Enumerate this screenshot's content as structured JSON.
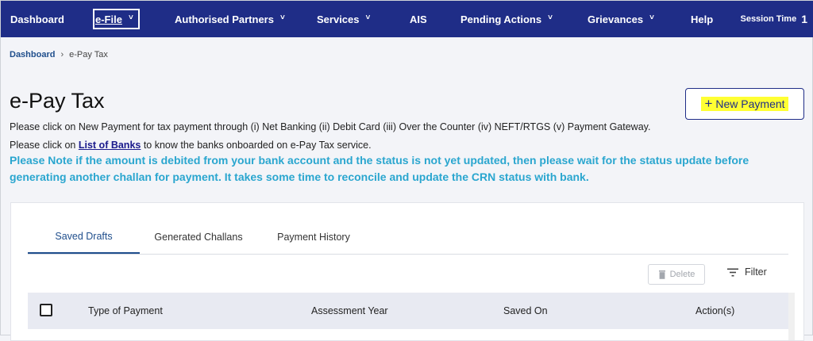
{
  "nav": {
    "items": [
      {
        "label": "Dashboard",
        "chevron": false
      },
      {
        "label": "e-File",
        "chevron": true
      },
      {
        "label": "Authorised Partners",
        "chevron": true
      },
      {
        "label": "Services",
        "chevron": true
      },
      {
        "label": "AIS",
        "chevron": false
      },
      {
        "label": "Pending Actions",
        "chevron": true
      },
      {
        "label": "Grievances",
        "chevron": true
      },
      {
        "label": "Help",
        "chevron": false
      }
    ],
    "session_label": "Session Time",
    "session_value": "1"
  },
  "breadcrumb": {
    "home": "Dashboard",
    "separator": "›",
    "current": "e-Pay Tax"
  },
  "page": {
    "title": "e-Pay Tax",
    "info1": "Please click on New Payment for tax payment through (i) Net Banking (ii) Debit Card (iii) Over the Counter (iv) NEFT/RTGS (v) Payment Gateway.",
    "info2_prefix": "Please click on ",
    "info2_link": "List of Banks",
    "info2_suffix": " to know the banks onboarded on e-Pay Tax service.",
    "notice": "Please Note if the amount is debited from your bank account and the status is not yet updated, then please wait for the status update before generating another challan for payment. It takes some time to reconcile and update the CRN status with bank."
  },
  "new_payment": {
    "icon": "plus-icon",
    "label": "New Payment"
  },
  "tabs": [
    {
      "label": "Saved Drafts",
      "active": true
    },
    {
      "label": "Generated Challans",
      "active": false
    },
    {
      "label": "Payment History",
      "active": false
    }
  ],
  "toolbar": {
    "delete_label": "Delete",
    "delete_icon": "trash-icon",
    "filter_label": "Filter",
    "filter_icon": "filter-icon"
  },
  "table": {
    "columns": [
      "Type of Payment",
      "Assessment Year",
      "Saved On",
      "Action(s)"
    ]
  },
  "colors": {
    "nav_bg": "#1f2d87",
    "notice": "#2aa6cf",
    "highlight": "#ffff33",
    "active_tab": "#1f4e8c"
  }
}
